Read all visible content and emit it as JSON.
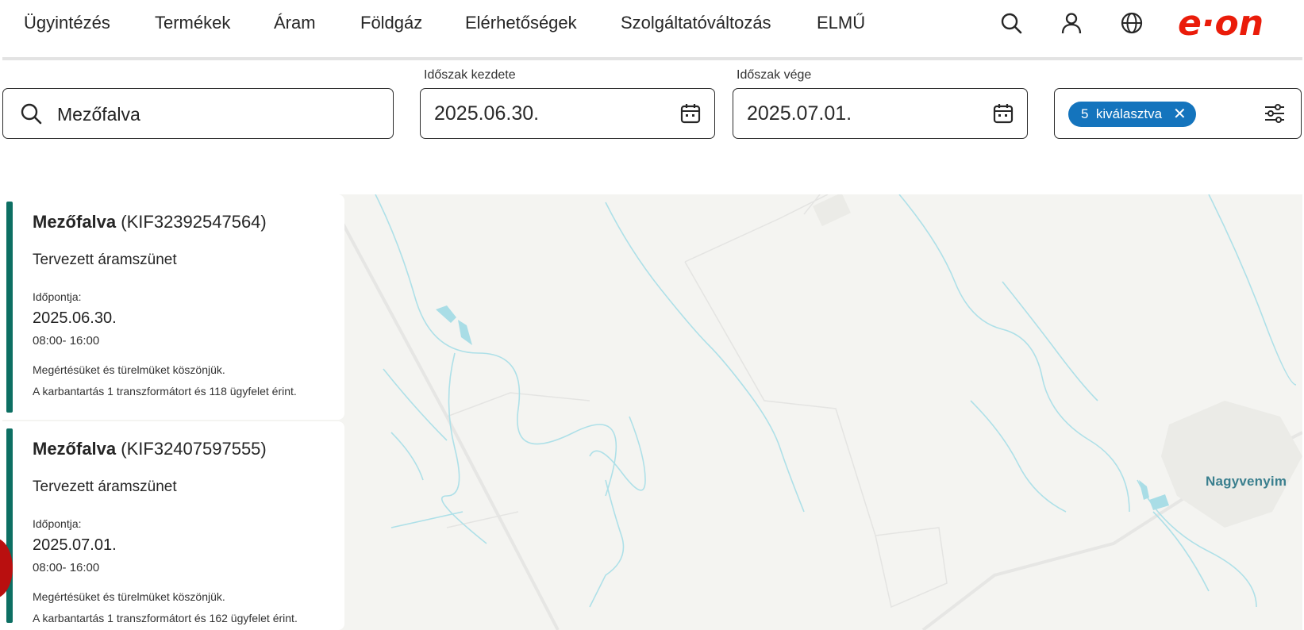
{
  "nav": {
    "items": [
      "Ügyintézés",
      "Termékek",
      "Áram",
      "Földgáz",
      "Elérhetőségek",
      "Szolgáltatóváltozás",
      "ELMŰ"
    ],
    "brand_color": "#ea1c0a",
    "icons": [
      "search-icon",
      "user-icon",
      "globe-icon"
    ],
    "brand": "e·on"
  },
  "filters": {
    "search_value": "Mezőfalva",
    "start_label": "Időszak kezdete",
    "start_value": "2025.06.30.",
    "end_label": "Időszak vége",
    "end_value": "2025.07.01.",
    "selected_chip": "5  kiválasztva",
    "chip_color": "#1474bd"
  },
  "map": {
    "place_label": "Nagyvenyim",
    "water_color": "#a9dde6",
    "land_color": "#f4f4f1"
  },
  "cards": [
    {
      "name": "Mezőfalva",
      "code": "(KIF32392547564)",
      "type": "Tervezett áramszünet",
      "when_label": "Időpontja:",
      "date": "2025.06.30.",
      "time": "08:00- 16:00",
      "msg1": "Megértésüket és türelmüket köszönjük.",
      "msg2": "A karbantartás 1 transzformátort és 118 ügyfelet érint."
    },
    {
      "name": "Mezőfalva",
      "code": "(KIF32407597555)",
      "type": "Tervezett áramszünet",
      "when_label": "Időpontja:",
      "date": "2025.07.01.",
      "time": "08:00- 16:00",
      "msg1": "Megértésüket és türelmüket köszönjük.",
      "msg2": "A karbantartás 1 transzformátort és 162 ügyfelet érint."
    }
  ],
  "accent_color": "#0d6f63"
}
